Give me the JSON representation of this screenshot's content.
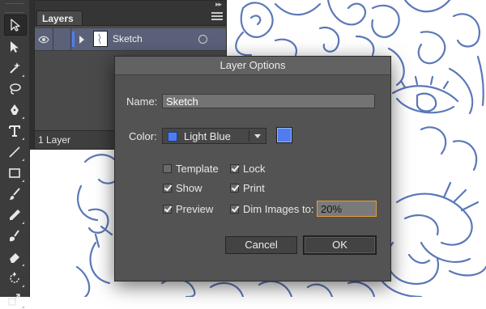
{
  "layers_panel": {
    "tab_label": "Layers",
    "layer": {
      "name": "Sketch",
      "color": "#4f7df0",
      "visible": true
    },
    "footer_count": "1 Layer"
  },
  "tools": [
    "selection-tool-icon",
    "direct-selection-tool-icon",
    "magic-wand-icon",
    "lasso-icon",
    "pen-tool-icon",
    "type-tool-icon",
    "line-tool-icon",
    "rectangle-tool-icon",
    "paintbrush-icon",
    "pencil-icon",
    "blob-brush-icon",
    "eraser-icon",
    "rotate-tool-icon",
    "scale-tool-icon"
  ],
  "dialog": {
    "title": "Layer Options",
    "name_label": "Name:",
    "name_value": "Sketch",
    "color_label": "Color:",
    "color_value": "Light Blue",
    "color_hex": "#4f7df0",
    "checkboxes": {
      "template": {
        "label": "Template",
        "checked": false
      },
      "lock": {
        "label": "Lock",
        "checked": true
      },
      "show": {
        "label": "Show",
        "checked": true
      },
      "print": {
        "label": "Print",
        "checked": true
      },
      "preview": {
        "label": "Preview",
        "checked": true
      },
      "dim": {
        "label": "Dim Images to:",
        "checked": true
      }
    },
    "dim_value": "20%",
    "cancel_label": "Cancel",
    "ok_label": "OK"
  }
}
